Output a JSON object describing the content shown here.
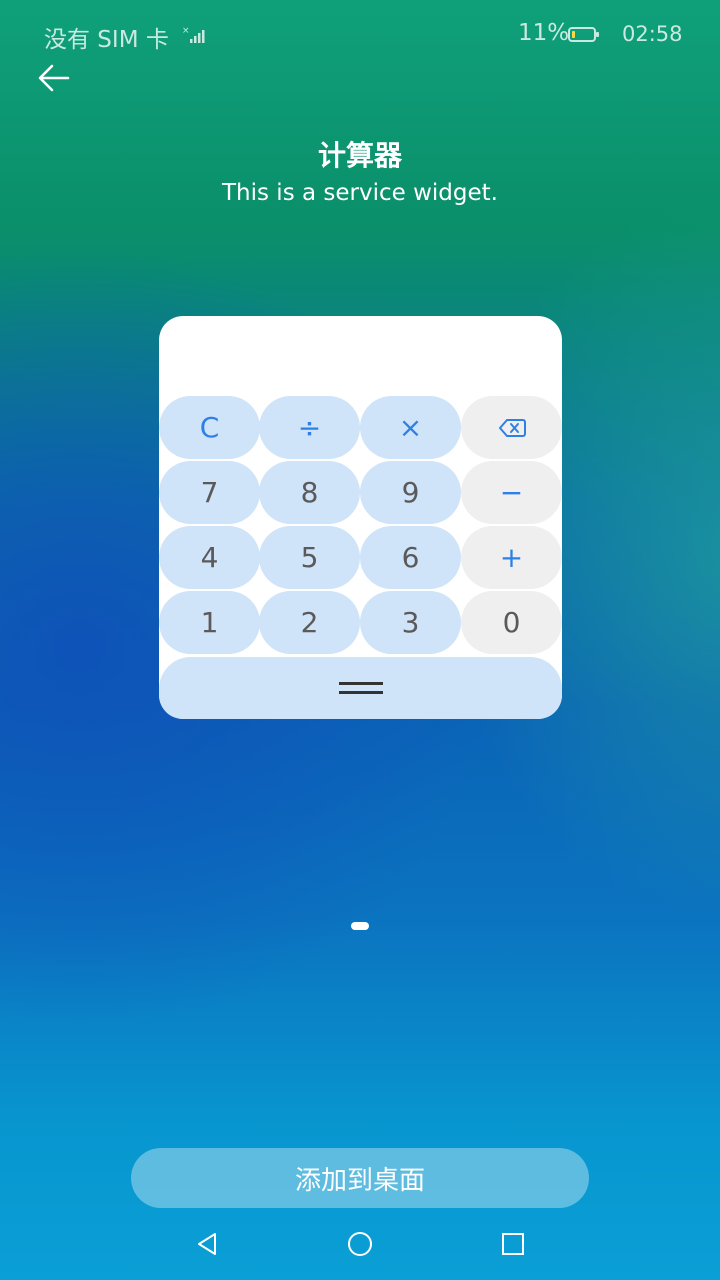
{
  "status_bar": {
    "sim_text": "没有 SIM 卡",
    "battery": "11%",
    "time": "02:58"
  },
  "header": {
    "title": "计算器",
    "subtitle": "This is a service widget."
  },
  "widget": {
    "rows": [
      [
        {
          "label": "C",
          "style": "blue",
          "op": true
        },
        {
          "label": "÷",
          "style": "blue",
          "op": true
        },
        {
          "label": "×",
          "style": "blue",
          "op": true
        },
        {
          "label": "",
          "icon": "backspace-icon",
          "style": "gray",
          "op": true
        }
      ],
      [
        {
          "label": "7",
          "style": "blue"
        },
        {
          "label": "8",
          "style": "blue"
        },
        {
          "label": "9",
          "style": "blue"
        },
        {
          "label": "−",
          "style": "gray",
          "op": true
        }
      ],
      [
        {
          "label": "4",
          "style": "blue"
        },
        {
          "label": "5",
          "style": "blue"
        },
        {
          "label": "6",
          "style": "blue"
        },
        {
          "label": "+",
          "style": "gray",
          "op": true
        }
      ],
      [
        {
          "label": "1",
          "style": "blue"
        },
        {
          "label": "2",
          "style": "blue"
        },
        {
          "label": "3",
          "style": "blue"
        },
        {
          "label": "0",
          "style": "gray"
        }
      ]
    ],
    "equals_icon": "equals-icon"
  },
  "add_button": {
    "label": "添加到桌面"
  },
  "colors": {
    "key_blue": "#cfe3f9",
    "key_gray": "#efefef",
    "operator": "#2f80e6"
  },
  "nav_bar": [
    "back-triangle-icon",
    "home-circle-icon",
    "recents-square-icon"
  ]
}
